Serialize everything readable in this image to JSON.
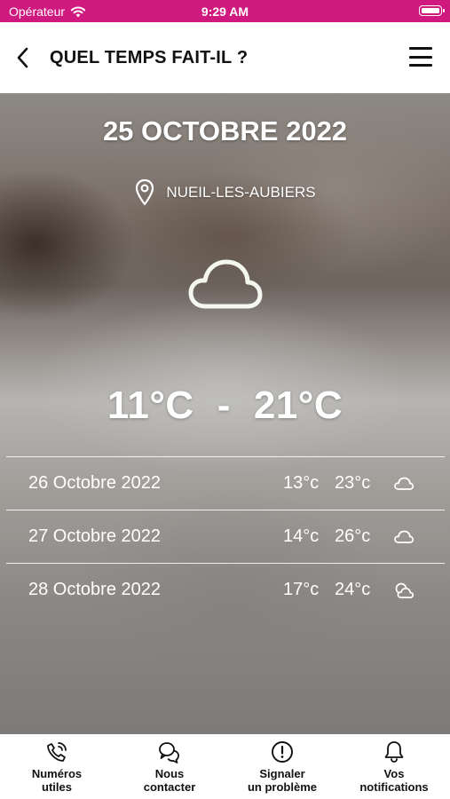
{
  "status_bar": {
    "carrier": "Opérateur",
    "time": "9:29 AM"
  },
  "header": {
    "title": "QUEL TEMPS FAIT-IL ?"
  },
  "weather": {
    "date": "25 OCTOBRE 2022",
    "location": "NUEIL-LES-AUBIERS",
    "icon": "cloud-icon",
    "temp_min": "11°C",
    "separator": "-",
    "temp_max": "21°C"
  },
  "forecast": [
    {
      "date": "26 Octobre 2022",
      "min": "13°c",
      "max": "23°c",
      "icon": "cloud-icon"
    },
    {
      "date": "27 Octobre 2022",
      "min": "14°c",
      "max": "26°c",
      "icon": "cloud-icon"
    },
    {
      "date": "28 Octobre 2022",
      "min": "17°c",
      "max": "24°c",
      "icon": "partly-cloudy-icon"
    }
  ],
  "bottom_nav": [
    {
      "line1": "Numéros",
      "line2": "utiles",
      "icon": "phone-icon"
    },
    {
      "line1": "Nous",
      "line2": "contacter",
      "icon": "chat-bubbles-icon"
    },
    {
      "line1": "Signaler",
      "line2": "un problème",
      "icon": "alert-circle-icon"
    },
    {
      "line1": "Vos",
      "line2": "notifications",
      "icon": "bell-icon"
    }
  ],
  "colors": {
    "status_bar": "#d0197f",
    "text_light": "#ffffff",
    "text_dark": "#111111"
  }
}
